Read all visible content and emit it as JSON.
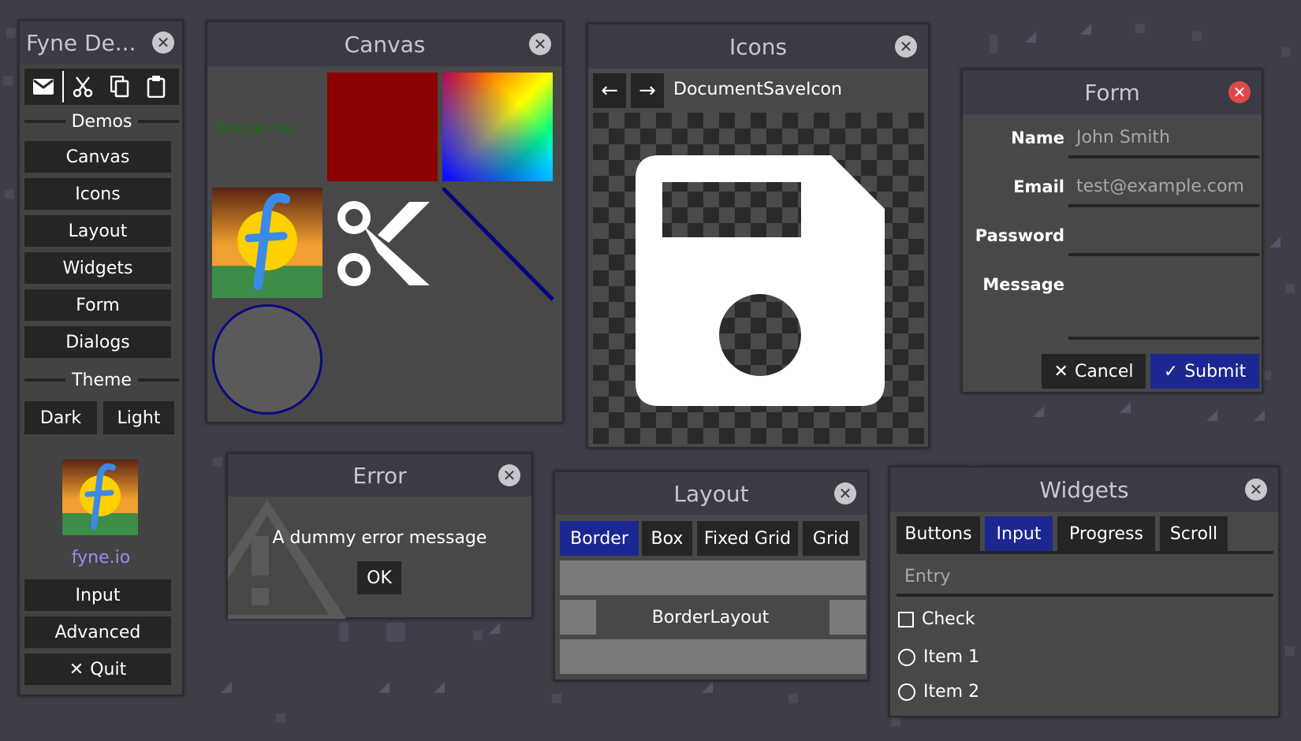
{
  "main_window": {
    "title": "Fyne De...",
    "toolbar": [
      "mail-icon",
      "cut-icon",
      "copy-icon",
      "paste-icon"
    ],
    "demos_header": "Demos",
    "demos": [
      "Canvas",
      "Icons",
      "Layout",
      "Widgets",
      "Form",
      "Dialogs"
    ],
    "theme_header": "Theme",
    "theme_dark": "Dark",
    "theme_light": "Light",
    "link": "fyne.io",
    "input": "Input",
    "advanced": "Advanced",
    "quit": "Quit"
  },
  "canvas_window": {
    "title": "Canvas",
    "resize_text": "Resize me",
    "colors": {
      "rect": "#8b0000",
      "line": "#000080",
      "circle_fill": "#5a5a5a",
      "circle_stroke": "#0a0a80",
      "resize_text": "#1a6e1a"
    }
  },
  "icons_window": {
    "title": "Icons",
    "icon_name": "DocumentSaveIcon"
  },
  "form_window": {
    "title": "Form",
    "name_label": "Name",
    "name_placeholder": "John Smith",
    "email_label": "Email",
    "email_placeholder": "test@example.com",
    "password_label": "Password",
    "message_label": "Message",
    "cancel": "Cancel",
    "submit": "Submit"
  },
  "error_window": {
    "title": "Error",
    "message": "A dummy error message",
    "ok": "OK"
  },
  "layout_window": {
    "title": "Layout",
    "tabs": [
      "Border",
      "Box",
      "Fixed Grid",
      "Grid"
    ],
    "active_tab": "Border",
    "center_label": "BorderLayout"
  },
  "widgets_window": {
    "title": "Widgets",
    "tabs": [
      "Buttons",
      "Input",
      "Progress",
      "Scroll"
    ],
    "active_tab": "Input",
    "entry_placeholder": "Entry",
    "check_label": "Check",
    "radio_items": [
      "Item 1",
      "Item 2"
    ]
  },
  "colors": {
    "primary": "#1c2792",
    "button": "#252525",
    "titlebar": "#3a3b44",
    "window_bg": "#484848",
    "link": "#9a8cf2",
    "close_red": "#e04848"
  }
}
